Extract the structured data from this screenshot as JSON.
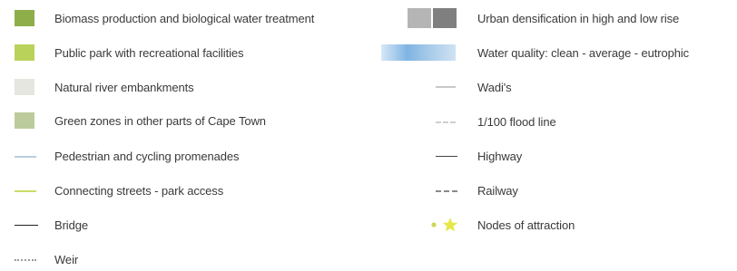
{
  "legend": {
    "left": [
      {
        "label": "Biomass production and biological water treatment",
        "symbol": "box-dark-green",
        "color": "#8eae4a"
      },
      {
        "label": "Public park with recreational facilities",
        "symbol": "box-light-green",
        "color": "#b9d35a"
      },
      {
        "label": "Natural river embankments",
        "symbol": "box-pale-grey",
        "color": "#e6e6e0"
      },
      {
        "label": "Green zones in other parts of Cape Town",
        "symbol": "box-sage",
        "color": "#bccb9c"
      },
      {
        "label": "Pedestrian and cycling promenades",
        "symbol": "line-light-blue",
        "color": "#b9cfe0"
      },
      {
        "label": "Connecting streets - park access",
        "symbol": "line-yellow-green",
        "color": "#c8dd6a"
      },
      {
        "label": "Bridge",
        "symbol": "line-black",
        "color": "#222222"
      },
      {
        "label": "Weir",
        "symbol": "line-dotted-grey",
        "color": "#9a9a9a"
      }
    ],
    "right": [
      {
        "label": "Urban densification in high and low rise",
        "symbol": "box-grey-pair",
        "color": "#9e9e9e"
      },
      {
        "label": "Water quality: clean - average - eutrophic",
        "symbol": "box-blue-gradient",
        "color": "#9cc3e6"
      },
      {
        "label": "Wadi's",
        "symbol": "line-light-grey",
        "color": "#c9c9c9"
      },
      {
        "label": "1/100 flood line",
        "symbol": "line-dashed-light",
        "color": "#cfcfcf"
      },
      {
        "label": "Highway",
        "symbol": "line-dark",
        "color": "#444444"
      },
      {
        "label": "Railway",
        "symbol": "line-dashed-grey",
        "color": "#8a8a8a"
      },
      {
        "label": "Nodes of attraction",
        "symbol": "star-yellow",
        "color": "#e6e84a"
      }
    ]
  }
}
